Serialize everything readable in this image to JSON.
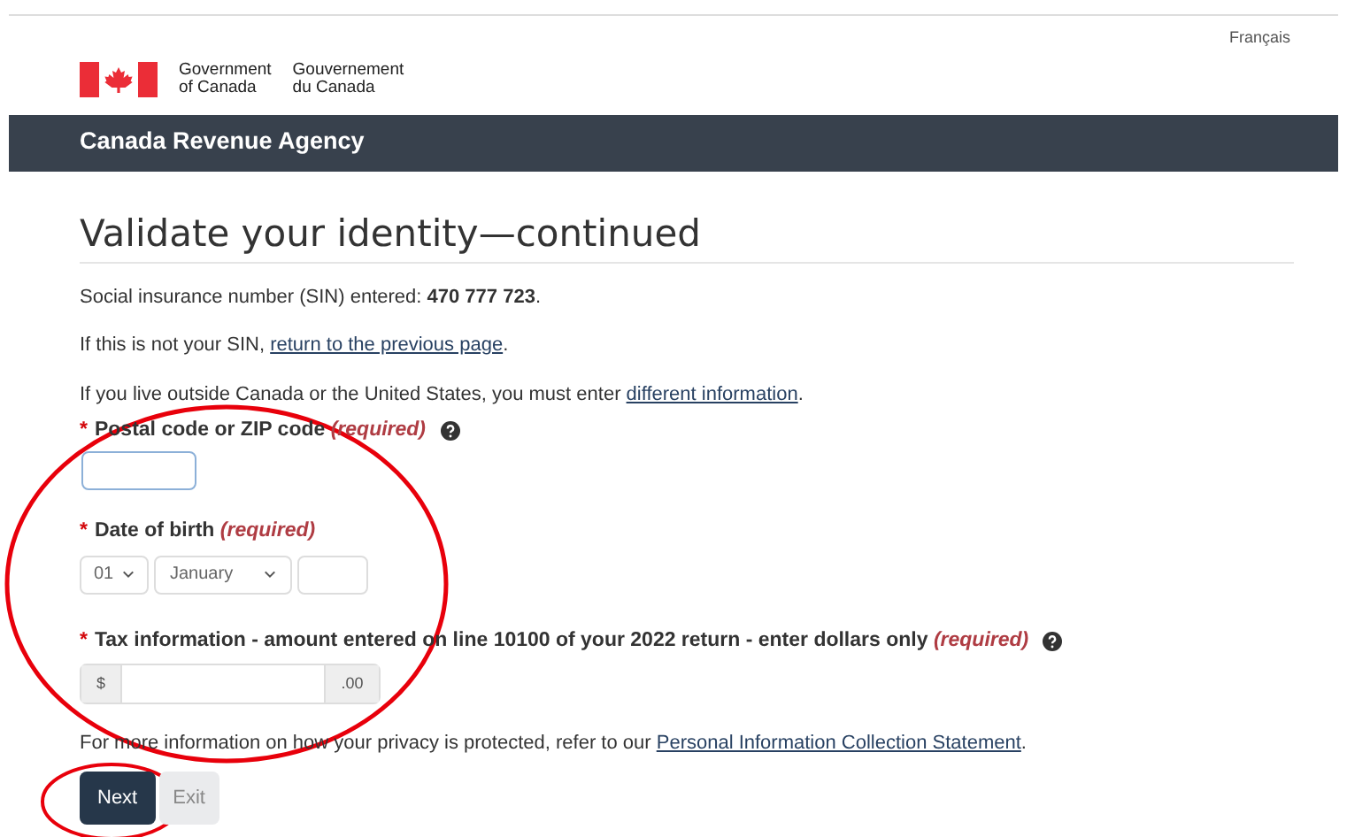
{
  "header": {
    "language_link": "Français",
    "signature": {
      "english": [
        "Government",
        "of Canada"
      ],
      "french": [
        "Gouvernement",
        "du Canada"
      ]
    },
    "agency": "Canada Revenue Agency"
  },
  "heading": "Validate your identity—continued",
  "paragraphs": [
    {
      "text": "Social insurance number (SIN) entered: **470 777 723**."
    },
    {
      "text": "If this is not your SIN, ",
      "link": "return to the previous page",
      "after": "."
    },
    {
      "text": "If you live outside Canada or the United States, you must enter ",
      "link": "different information",
      "after": "."
    }
  ],
  "fields": [
    {
      "kind": "text",
      "marker": "*",
      "label": "Postal code or ZIP code",
      "required": "(required)",
      "help": true
    },
    {
      "kind": "date",
      "marker": "*",
      "label": "Date of birth",
      "required": "(required)",
      "help": false,
      "day": "01",
      "month": "January"
    },
    {
      "kind": "amount",
      "marker": "*",
      "label": "Tax information - amount entered on line 10100 of your 2022 return - enter dollars only",
      "required": "(required)",
      "help": true,
      "prefix": "$",
      "suffix": ".00"
    }
  ],
  "privacy": {
    "text": "For more information on how your privacy is protected, refer to our ",
    "link": "Personal Information Collection Statement",
    "after": "."
  },
  "buttons": [
    {
      "label": "Next",
      "kind": "primary"
    },
    {
      "label": "Exit",
      "kind": "secondary"
    }
  ]
}
